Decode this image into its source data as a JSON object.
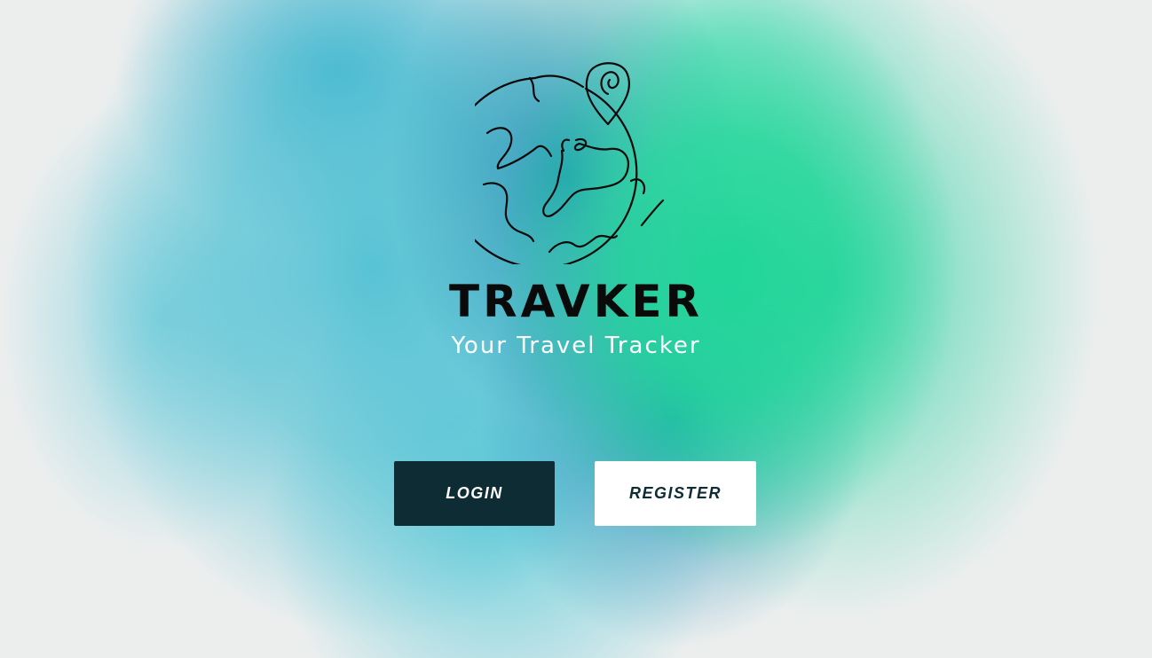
{
  "app": {
    "name": "TRAVKER",
    "tagline": "Your Travel Tracker"
  },
  "actions": {
    "login_label": "LOGIN",
    "register_label": "REGISTER"
  },
  "colors": {
    "primary_button": "#0d2c33",
    "secondary_button": "#ffffff",
    "brand_text": "#0a0a0a",
    "tagline_text": "#ffffff"
  },
  "icons": {
    "logo": "globe-with-map-pin-icon"
  }
}
